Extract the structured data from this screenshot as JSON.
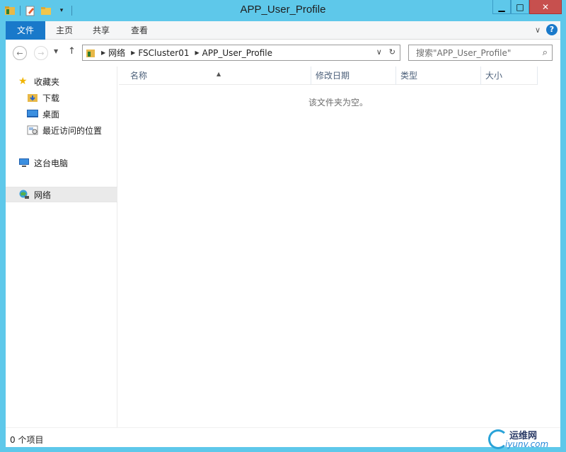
{
  "window": {
    "title": "APP_User_Profile"
  },
  "ribbon": {
    "tabs": [
      {
        "label": "文件"
      },
      {
        "label": "主页"
      },
      {
        "label": "共享"
      },
      {
        "label": "查看"
      }
    ],
    "help": "?"
  },
  "address": {
    "crumbs": [
      "网络",
      "FSCluster01",
      "APP_User_Profile"
    ]
  },
  "search": {
    "placeholder": "搜索\"APP_User_Profile\""
  },
  "nav": {
    "favorites": "收藏夹",
    "downloads": "下载",
    "desktop": "桌面",
    "recent": "最近访问的位置",
    "this_pc": "这台电脑",
    "network": "网络"
  },
  "columns": [
    "名称",
    "修改日期",
    "类型",
    "大小"
  ],
  "empty_message": "该文件夹为空。",
  "status": {
    "item_count": "0 个项目"
  },
  "watermark": {
    "line1": "运维网",
    "line2": "iyunv.com"
  }
}
